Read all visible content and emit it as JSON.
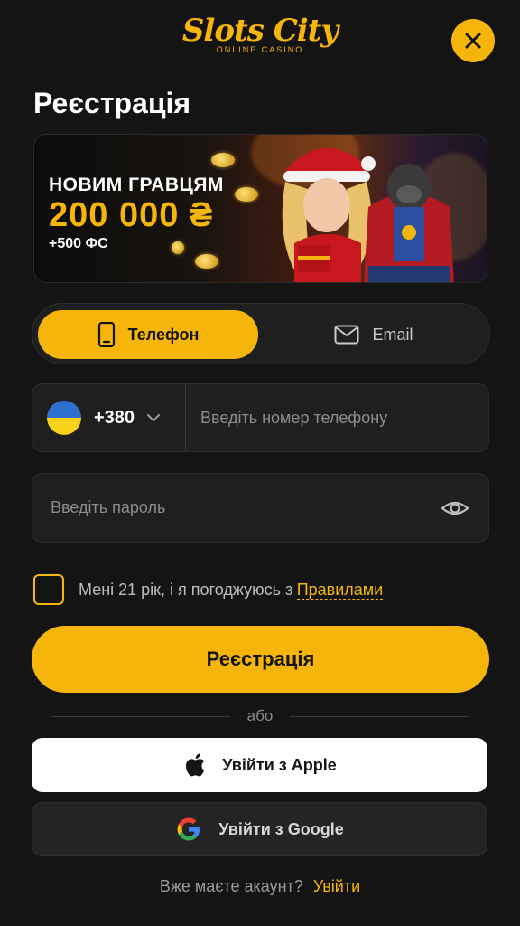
{
  "header": {
    "logo_main": "Slots City",
    "logo_sub": "ONLINE CASINO",
    "close_icon": "close-icon"
  },
  "page": {
    "title": "Реєстрація"
  },
  "banner": {
    "headline": "НОВИМ ГРАВЦЯМ",
    "amount": "200 000 ₴",
    "bonus": "+500 ФС"
  },
  "tabs": [
    {
      "label": "Телефон",
      "icon": "phone-icon",
      "active": true
    },
    {
      "label": "Email",
      "icon": "mail-icon",
      "active": false
    }
  ],
  "phone": {
    "country_flag": "ukraine-flag-icon",
    "country_code": "+380",
    "placeholder": "Введіть номер телефону",
    "value": ""
  },
  "password": {
    "placeholder": "Введіть пароль",
    "value": ""
  },
  "agreement": {
    "text": "Мені 21 рік, і я погоджуюсь з",
    "link": "Правилами",
    "checked": false
  },
  "submit_label": "Реєстрація",
  "or_label": "або",
  "social": {
    "apple_label": "Увійти з Apple",
    "google_label": "Увійти з Google"
  },
  "footer": {
    "question": "Вже маєте акаунт?",
    "login_link": "Увійти"
  },
  "colors": {
    "accent": "#f5b50a",
    "background": "#141414",
    "field": "#1f1f1f"
  }
}
